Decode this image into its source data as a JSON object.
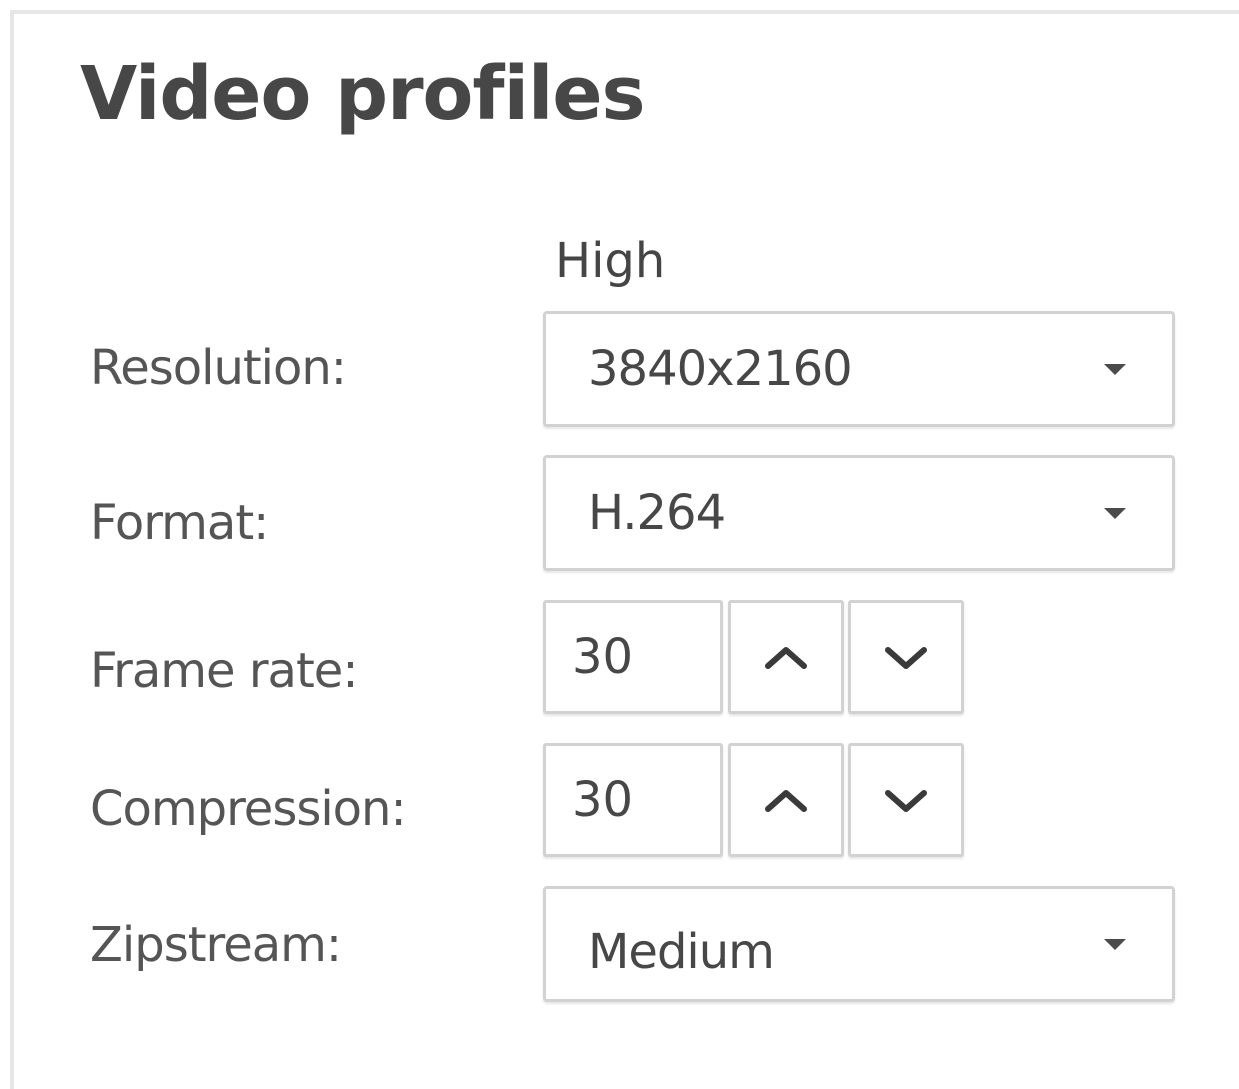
{
  "panel": {
    "title": "Video profiles",
    "column_header": "High"
  },
  "fields": {
    "resolution": {
      "label": "Resolution:",
      "value": "3840x2160"
    },
    "format": {
      "label": "Format:",
      "value": "H.264"
    },
    "frame_rate": {
      "label": "Frame rate:",
      "value": "30"
    },
    "compression": {
      "label": "Compression:",
      "value": "30"
    },
    "zipstream": {
      "label": "Zipstream:",
      "value": "Medium"
    }
  },
  "icons": {
    "dropdown": "caret-down-icon",
    "increment": "chevron-up-icon",
    "decrement": "chevron-down-icon"
  },
  "colors": {
    "text": "#474747",
    "border": "#d2d2d2",
    "frame": "#e6e6e6"
  }
}
